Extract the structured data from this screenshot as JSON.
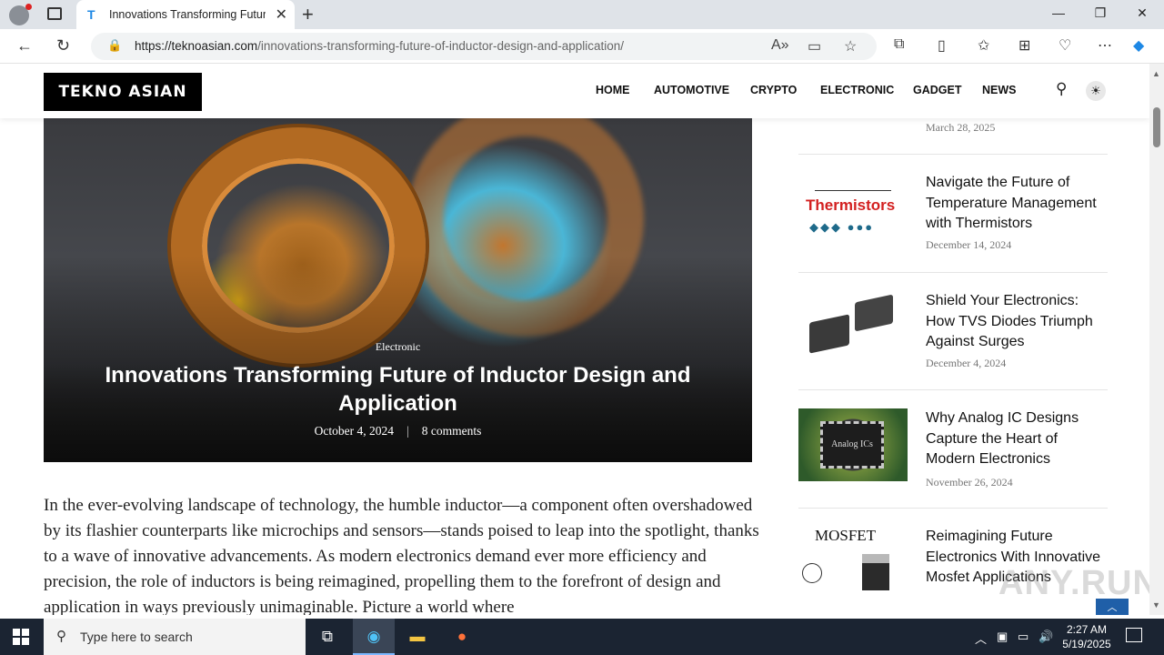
{
  "browser": {
    "tab_title": "Innovations Transforming Future of Inductor Design and Application",
    "tab_favicon": "T",
    "url_domain": "https://teknoasian.com",
    "url_path": "/innovations-transforming-future-of-inductor-design-and-application/"
  },
  "site": {
    "logo": "TEKNO ASIAN",
    "menu": [
      "HOME",
      "AUTOMOTIVE",
      "CRYPTO",
      "ELECTRONIC",
      "GADGET",
      "NEWS"
    ]
  },
  "hero": {
    "category": "Electronic",
    "title": "Innovations Transforming Future of Inductor Design and Application",
    "date": "October 4, 2024",
    "comments": "8 comments"
  },
  "article": {
    "intro": "In the ever-evolving landscape of technology, the humble inductor—a component often overshadowed by its flashier counterparts like microchips and sensors—stands poised to leap into the spotlight, thanks to a wave of innovative advancements. As modern electronics demand ever more efficiency and precision, the role of inductors is being reimagined, propelling them to the forefront of design and application in ways previously unimaginable. Picture a world where"
  },
  "sidebar": {
    "top_date": "March 28, 2025",
    "items": [
      {
        "title": "Navigate the Future of Temperature Management with Thermistors",
        "date": "December 14, 2024",
        "thumb_label": "Thermistors"
      },
      {
        "title": "Shield Your Electronics: How TVS Diodes Triumph Against Surges",
        "date": "December 4, 2024"
      },
      {
        "title": "Why Analog IC Designs Capture the Heart of Modern Electronics",
        "date": "November 26, 2024",
        "thumb_label": "Analog ICs"
      },
      {
        "title": "Reimagining Future Electronics With Innovative Mosfet Applications",
        "date": "",
        "thumb_label": "MOSFET"
      }
    ]
  },
  "watermark": "ANY.RUN",
  "taskbar": {
    "search_placeholder": "Type here to search",
    "time": "2:27 AM",
    "date": "5/19/2025"
  },
  "colors": {
    "accent": "#1f5fa8",
    "logo_bg": "#000000",
    "taskbar": "#1b2432"
  }
}
